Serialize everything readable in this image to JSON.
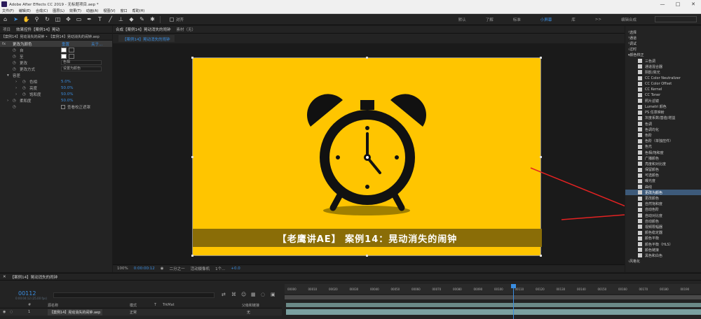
{
  "window": {
    "title": "Adobe After Effects CC 2019 - 无标题项目.aep *",
    "controls": [
      "—",
      "□",
      "✕"
    ]
  },
  "menu": [
    "文件(F)",
    "编辑(E)",
    "合成(C)",
    "图层(L)",
    "效果(T)",
    "动画(A)",
    "视图(V)",
    "窗口",
    "帮助(H)"
  ],
  "toolbar": {
    "snap_label": "对齐",
    "workspaces": [
      "默认",
      "了解",
      "标准",
      "小屏幕",
      "库",
      ">>",
      "编辑合成"
    ],
    "active_workspace": "小屏幕"
  },
  "left_panel": {
    "tabs": [
      "项目",
      "效果控件【案例14】晃动"
    ],
    "header": "【案例14】晃动消失的闹钟 • 【案例14】晃动消失的闹钟.aep",
    "effect_name": "更改为颜色",
    "reset": "重置",
    "about": "关于...",
    "rows": [
      {
        "label": "自",
        "type": "swatch"
      },
      {
        "label": "至",
        "type": "swatch"
      },
      {
        "label": "更改",
        "type": "select",
        "value": "色相"
      },
      {
        "label": "更改方式",
        "type": "select",
        "value": "设置为颜色"
      },
      {
        "label": "容差",
        "type": "group"
      },
      {
        "label": "色相",
        "type": "value",
        "value": "5.0%"
      },
      {
        "label": "亮度",
        "type": "value",
        "value": "50.0%"
      },
      {
        "label": "饱和度",
        "type": "value",
        "value": "50.0%"
      },
      {
        "label": "柔和度",
        "type": "value",
        "value": "50.0%"
      },
      {
        "label": "",
        "type": "checkbox",
        "value": "查看校正遮罩"
      }
    ]
  },
  "viewer": {
    "tabs": [
      "合成【案例14】晃动消失的闹钟",
      "素材（无）"
    ],
    "breadcrumb": "【案例14】晃动消失的闹钟",
    "banner_text": "【老鹰讲AE】 案例14：晃动消失的闹钟",
    "controls": [
      "100%",
      "0:00:00:12",
      "二分之一",
      "活动摄像机",
      "1个...",
      "+0.0"
    ],
    "colors": {
      "background": "#ffc500",
      "banner": "#8a6d07",
      "clock": "#111111",
      "shadow": "#a08000"
    }
  },
  "right_panel": {
    "items": [
      "选择",
      "通道",
      "调试",
      "过时",
      "颜色校正",
      "三色调",
      "通道混合器",
      "阴影/高光",
      "CC Color Neutralizer",
      "CC Color Offset",
      "CC Kernel",
      "CC Toner",
      "照片滤镜",
      "Lumetri 颜色",
      "PS 任意映射",
      "灰度系数/基值/增益",
      "色调",
      "色调均化",
      "色阶",
      "色阶（单独控件）",
      "色光",
      "色相/饱和度",
      "广播颜色",
      "亮度和对比度",
      "保留颜色",
      "可选颜色",
      "曝光度",
      "曲线",
      "更改为颜色",
      "更改颜色",
      "自然饱和度",
      "自动色阶",
      "自动对比度",
      "自动颜色",
      "视频限幅器",
      "颜色稳定器",
      "颜色平衡",
      "颜色平衡（HLS）",
      "颜色链接",
      "黑色和白色",
      "风格化"
    ],
    "highlighted": "更改为颜色"
  },
  "timeline": {
    "tab": "【案例14】晃动消失的闹钟",
    "current_time": "00112",
    "sub_time": "0:00:04:12 (25.00 fps)",
    "columns": [
      "#",
      "源名称",
      "模式",
      "T",
      "TrkMat",
      "父级和链接"
    ],
    "layer": {
      "index": "1",
      "name": "【案例14】晃动消失的闹钟.aep",
      "mode": "正常",
      "parent": "无"
    },
    "ruler_ticks": [
      "00000",
      "00010",
      "00020",
      "00030",
      "00040",
      "00050",
      "00060",
      "00070",
      "00080",
      "00090",
      "00100",
      "00110",
      "00120",
      "00130",
      "00140",
      "00150",
      "00160",
      "00170",
      "00180",
      "00190"
    ],
    "playhead_frame": 112
  }
}
